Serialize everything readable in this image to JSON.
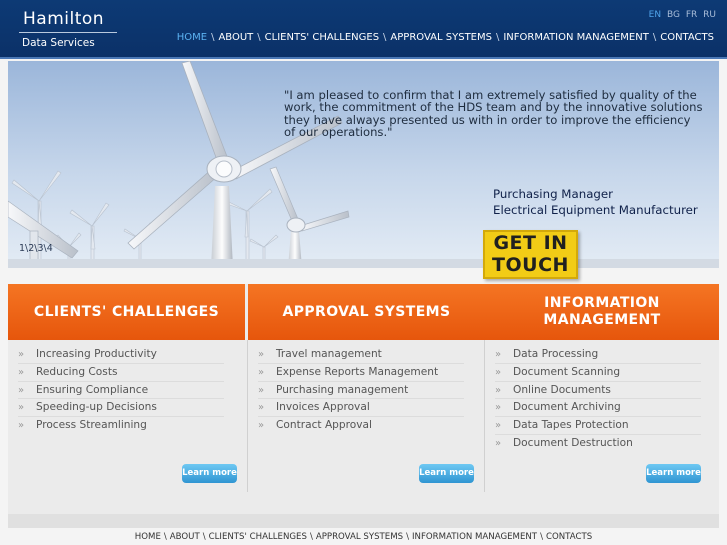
{
  "header": {
    "logo_title": "Hamilton",
    "logo_subtitle": "Data Services",
    "languages": [
      "EN",
      "BG",
      "FR",
      "RU"
    ],
    "active_language": "EN",
    "nav": [
      "HOME",
      "ABOUT",
      "CLIENTS' CHALLENGES",
      "APPROVAL SYSTEMS",
      "INFORMATION MANAGEMENT",
      "CONTACTS"
    ],
    "nav_separator": "\\",
    "active_nav": "HOME"
  },
  "hero": {
    "quote": "\"I am pleased to confirm that I am extremely satisfied by quality of the work, the commitment of the HDS team and by the innovative solutions they have always presented us with in order to improve the efficiency of our operations.\"",
    "attribution_role": "Purchasing Manager",
    "attribution_company": "Electrical Equipment Manufacturer",
    "slides": [
      "1",
      "2",
      "3",
      "4"
    ],
    "slide_separator": "\\",
    "cta_line1": "GET IN",
    "cta_line2": "TOUCH"
  },
  "columns": [
    {
      "title": "CLIENTS' CHALLENGES",
      "items": [
        "Increasing Productivity",
        "Reducing Costs",
        "Ensuring Compliance",
        "Speeding-up Decisions",
        "Process Streamlining"
      ],
      "button": "Learn more"
    },
    {
      "title": "APPROVAL SYSTEMS",
      "items": [
        "Travel management",
        "Expense Reports Management",
        "Purchasing management",
        "Invoices Approval",
        "Contract Approval"
      ],
      "button": "Learn more"
    },
    {
      "title": "INFORMATION MANAGEMENT",
      "items": [
        "Data Processing",
        "Document Scanning",
        "Online Documents",
        "Document Archiving",
        "Data Tapes Protection",
        "Document Destruction"
      ],
      "button": "Learn more"
    }
  ],
  "footer": {
    "nav": [
      "HOME",
      "ABOUT",
      "CLIENTS' CHALLENGES",
      "APPROVAL SYSTEMS",
      "INFORMATION MANAGEMENT",
      "CONTACTS"
    ],
    "nav_separator": "\\"
  },
  "colors": {
    "header_bg": "#0d3a75",
    "accent_blue": "#5bb2f2",
    "orange": "#f57523",
    "cta_yellow": "#f2cc16",
    "button_blue": "#2f95d2"
  }
}
